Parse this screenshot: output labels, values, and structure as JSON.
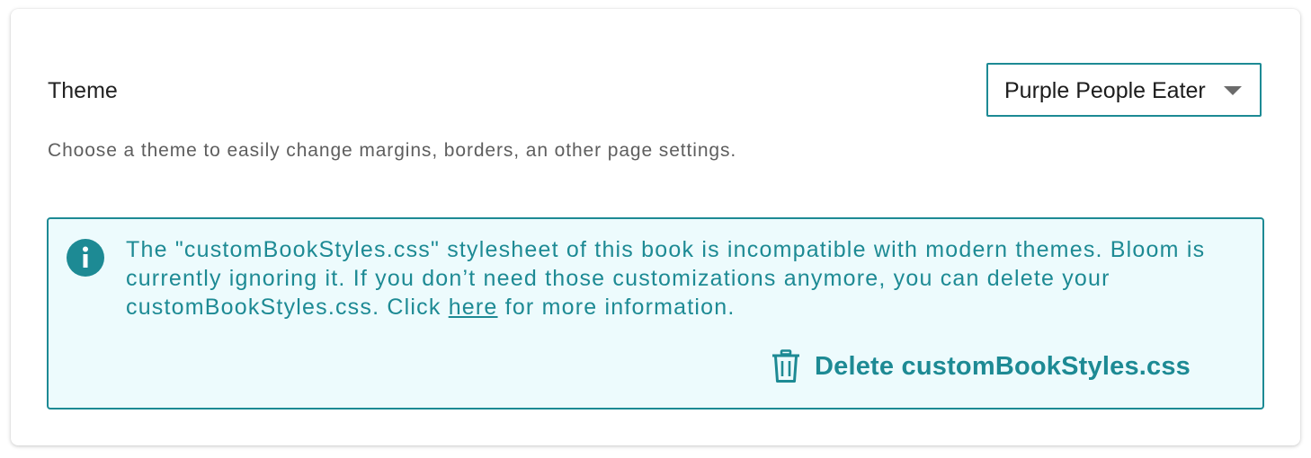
{
  "theme": {
    "label": "Theme",
    "selected": "Purple People Eater",
    "help": "Choose a theme to easily change margins, borders, an other page settings."
  },
  "notice": {
    "text_before_link": "The \"customBookStyles.css\" stylesheet of this book is incompatible with modern themes. Bloom is currently ignoring it. If you don’t need those customizations anymore, you can delete your customBookStyles.css. Click ",
    "link_text": "here",
    "text_after_link": " for more information.",
    "delete_label": "Delete customBookStyles.css"
  },
  "icons": {
    "info": "info-icon",
    "dropdown": "chevron-down-icon",
    "delete": "trash-icon"
  },
  "colors": {
    "accent": "#1d8a94",
    "notice_background": "#edfbfd",
    "help_text": "#5e5e5e",
    "primary_text": "#222222"
  }
}
